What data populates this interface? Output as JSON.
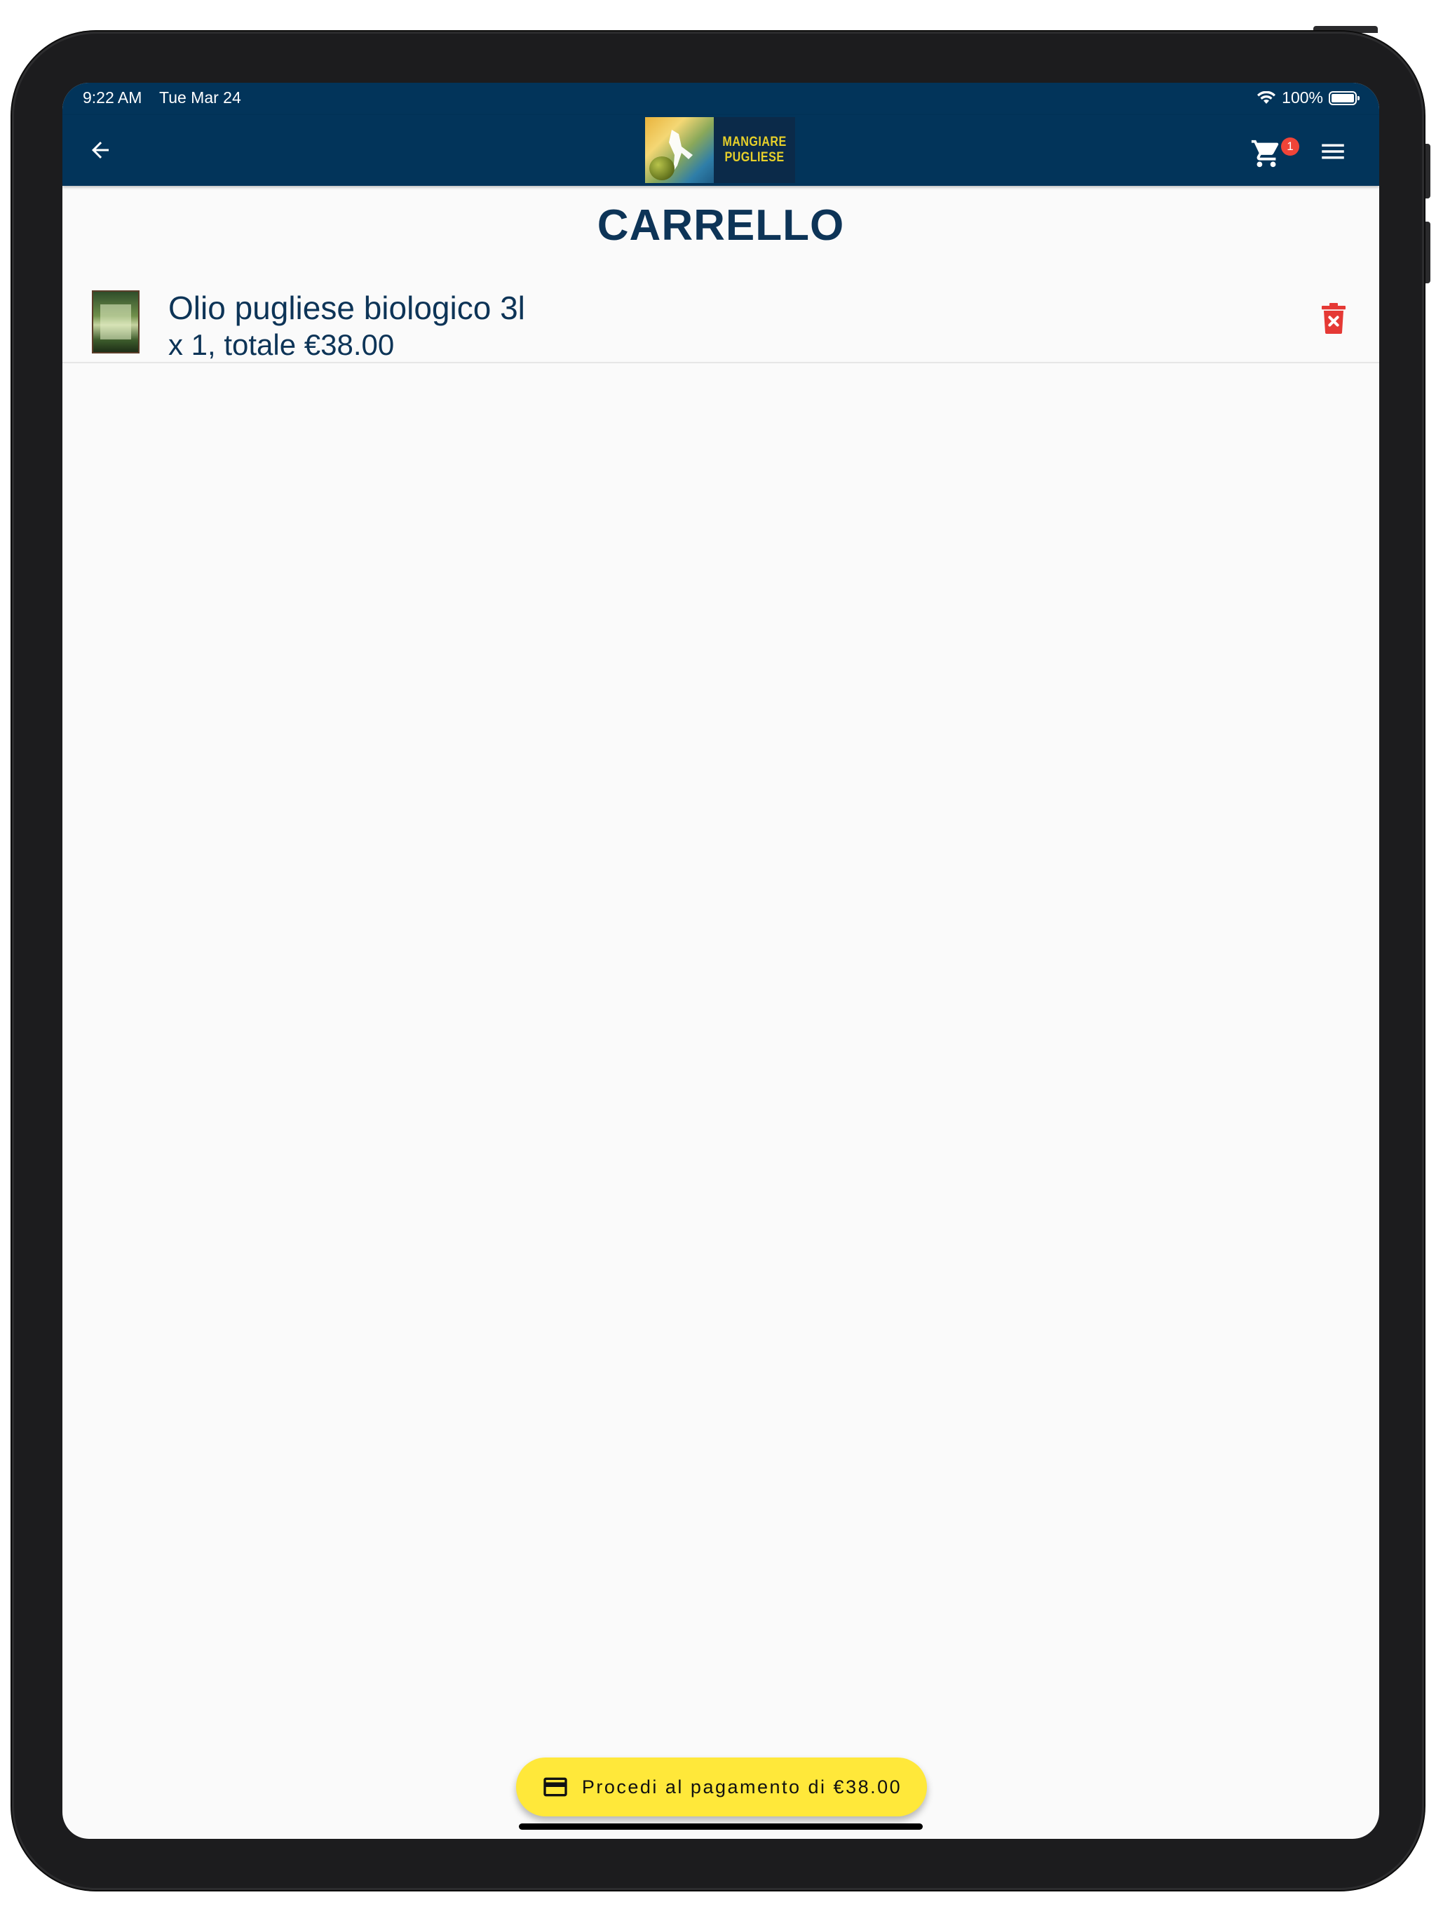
{
  "status_bar": {
    "time": "9:22 AM",
    "date": "Tue Mar 24",
    "battery_percent": "100%",
    "battery_level": 1.0,
    "icons": [
      "wifi-icon",
      "battery-icon"
    ]
  },
  "app_bar": {
    "back_icon": "arrow-left-icon",
    "logo_line1": "MANGIARE",
    "logo_line2": "PUGLIESE",
    "cart_icon": "shopping-cart-icon",
    "cart_count": "1",
    "menu_icon": "hamburger-menu-icon"
  },
  "page": {
    "title": "CARRELLO"
  },
  "cart": {
    "items": [
      {
        "name": "Olio pugliese biologico 3l",
        "detail": "x 1, totale €38.00",
        "delete_icon": "trash-delete-icon"
      }
    ]
  },
  "checkout": {
    "label": "Procedi al pagamento di €38.00",
    "icon": "credit-card-icon"
  },
  "colors": {
    "app_bar": "#02345a",
    "title_text": "#0d3457",
    "pay_button": "#ffe83a",
    "delete_red": "#e53935",
    "badge": "#f04438"
  }
}
